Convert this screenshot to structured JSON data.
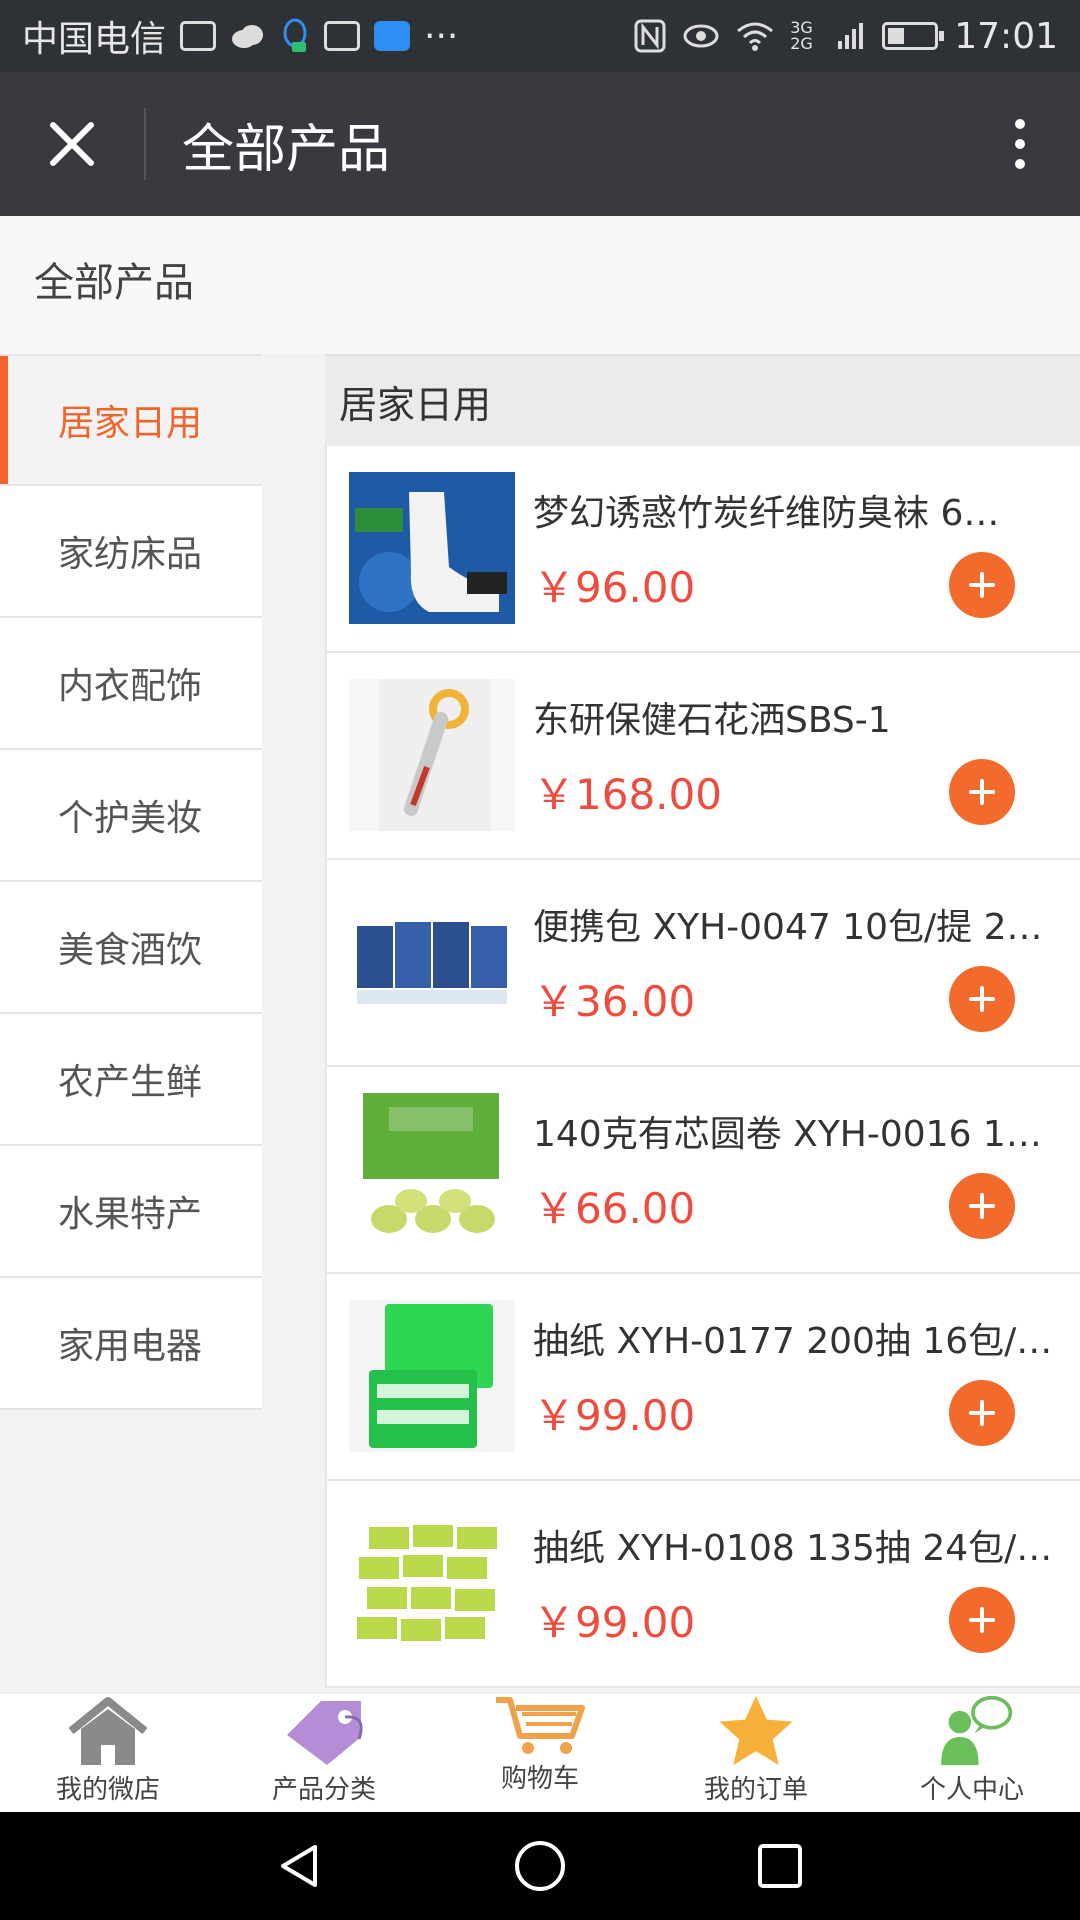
{
  "status_bar": {
    "carrier": "中国电信",
    "network": "3G 2G",
    "time": "17:01"
  },
  "title_bar": {
    "title": "全部产品"
  },
  "page_header": {
    "label": "全部产品"
  },
  "sidebar": {
    "items": [
      {
        "label": "居家日用",
        "active": true
      },
      {
        "label": "家纺床品",
        "active": false
      },
      {
        "label": "内衣配饰",
        "active": false
      },
      {
        "label": "个护美妆",
        "active": false
      },
      {
        "label": "美食酒饮",
        "active": false
      },
      {
        "label": "农产生鲜",
        "active": false
      },
      {
        "label": "水果特产",
        "active": false
      },
      {
        "label": "家用电器",
        "active": false
      }
    ]
  },
  "products": {
    "section_title": "居家日用",
    "items": [
      {
        "name": "梦幻诱惑竹炭纤维防臭袜 6…",
        "price": "￥96.00"
      },
      {
        "name": "东研保健石花洒SBS-1",
        "price": "￥168.00"
      },
      {
        "name": "便携包 XYH-0047 10包/提 2…",
        "price": "￥36.00"
      },
      {
        "name": "140克有芯圆卷 XYH-0016 1…",
        "price": "￥66.00"
      },
      {
        "name": "抽纸 XYH-0177 200抽 16包/…",
        "price": "￥99.00"
      },
      {
        "name": "抽纸 XYH-0108 135抽 24包/…",
        "price": "￥99.00"
      }
    ]
  },
  "bottom_nav": {
    "items": [
      {
        "label": "我的微店",
        "icon": "home-icon"
      },
      {
        "label": "产品分类",
        "icon": "tag-icon"
      },
      {
        "label": "购物车",
        "icon": "cart-icon"
      },
      {
        "label": "我的订单",
        "icon": "star-icon"
      },
      {
        "label": "个人中心",
        "icon": "user-icon"
      }
    ]
  },
  "colors": {
    "accent": "#f1652c",
    "price": "#ef4c3f",
    "titlebar": "#393a3f"
  }
}
